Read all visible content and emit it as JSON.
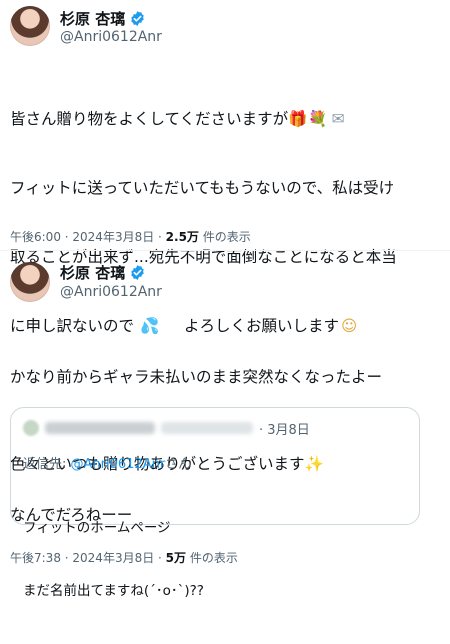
{
  "tweet1": {
    "name": "杉原 杏璃",
    "handle": "@Anri0612Anr",
    "line1": "皆さん贈り物をよくしてくださいますが",
    "line1_emojis": [
      "🎁",
      "💐",
      "✉"
    ],
    "line2": "フィットに送っていただいてももうないので、私は受け",
    "line3": "取ることが出来ず...宛先不明で面倒なことになると本当",
    "line4a": "に申し訳ないので",
    "line4_emoji1": "💦",
    "line4b": "よろしくお願いします",
    "line4_emoji2": "☺",
    "line5": "色々といつも贈り物ありがとうございます",
    "line5_emoji": "✨",
    "time": "午後6:00",
    "date": "2024年3月8日",
    "views": "2.5万",
    "views_label": "件の表示"
  },
  "tweet2": {
    "name": "杉原 杏璃",
    "handle": "@Anri0612Anr",
    "line1": "かなり前からギャラ未払いのまま突然なくなったよー",
    "line2": "なんでだろねーー",
    "time": "午後7:38",
    "date": "2024年3月8日",
    "views": "5万",
    "views_label": "件の表示",
    "quote": {
      "date": "3月8日",
      "reply_prefix": "返信先: ",
      "reply_handle": "@Anri0612Anr",
      "reply_suffix": "さん",
      "text_line1": "フィットのホームページ",
      "text_line2": "まだ名前出てますね(´･o･`)??"
    }
  },
  "colors": {
    "verified": "#1d9bf0",
    "secondary_text": "#536471",
    "link": "#1d9bf0"
  },
  "icons": [
    "verified-badge-icon",
    "gift-icon",
    "bouquet-icon",
    "envelope-icon",
    "sweat-drops-icon",
    "smiling-face-icon",
    "sparkles-icon"
  ]
}
